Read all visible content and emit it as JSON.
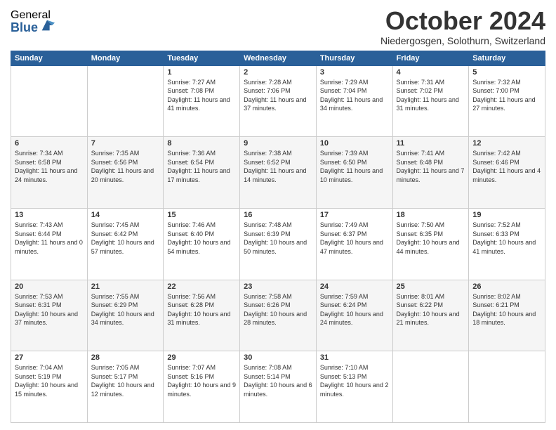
{
  "logo": {
    "general": "General",
    "blue": "Blue"
  },
  "header": {
    "month": "October 2024",
    "location": "Niedergosgen, Solothurn, Switzerland"
  },
  "weekdays": [
    "Sunday",
    "Monday",
    "Tuesday",
    "Wednesday",
    "Thursday",
    "Friday",
    "Saturday"
  ],
  "weeks": [
    [
      {
        "day": "",
        "info": ""
      },
      {
        "day": "",
        "info": ""
      },
      {
        "day": "1",
        "info": "Sunrise: 7:27 AM\nSunset: 7:08 PM\nDaylight: 11 hours and 41 minutes."
      },
      {
        "day": "2",
        "info": "Sunrise: 7:28 AM\nSunset: 7:06 PM\nDaylight: 11 hours and 37 minutes."
      },
      {
        "day": "3",
        "info": "Sunrise: 7:29 AM\nSunset: 7:04 PM\nDaylight: 11 hours and 34 minutes."
      },
      {
        "day": "4",
        "info": "Sunrise: 7:31 AM\nSunset: 7:02 PM\nDaylight: 11 hours and 31 minutes."
      },
      {
        "day": "5",
        "info": "Sunrise: 7:32 AM\nSunset: 7:00 PM\nDaylight: 11 hours and 27 minutes."
      }
    ],
    [
      {
        "day": "6",
        "info": "Sunrise: 7:34 AM\nSunset: 6:58 PM\nDaylight: 11 hours and 24 minutes."
      },
      {
        "day": "7",
        "info": "Sunrise: 7:35 AM\nSunset: 6:56 PM\nDaylight: 11 hours and 20 minutes."
      },
      {
        "day": "8",
        "info": "Sunrise: 7:36 AM\nSunset: 6:54 PM\nDaylight: 11 hours and 17 minutes."
      },
      {
        "day": "9",
        "info": "Sunrise: 7:38 AM\nSunset: 6:52 PM\nDaylight: 11 hours and 14 minutes."
      },
      {
        "day": "10",
        "info": "Sunrise: 7:39 AM\nSunset: 6:50 PM\nDaylight: 11 hours and 10 minutes."
      },
      {
        "day": "11",
        "info": "Sunrise: 7:41 AM\nSunset: 6:48 PM\nDaylight: 11 hours and 7 minutes."
      },
      {
        "day": "12",
        "info": "Sunrise: 7:42 AM\nSunset: 6:46 PM\nDaylight: 11 hours and 4 minutes."
      }
    ],
    [
      {
        "day": "13",
        "info": "Sunrise: 7:43 AM\nSunset: 6:44 PM\nDaylight: 11 hours and 0 minutes."
      },
      {
        "day": "14",
        "info": "Sunrise: 7:45 AM\nSunset: 6:42 PM\nDaylight: 10 hours and 57 minutes."
      },
      {
        "day": "15",
        "info": "Sunrise: 7:46 AM\nSunset: 6:40 PM\nDaylight: 10 hours and 54 minutes."
      },
      {
        "day": "16",
        "info": "Sunrise: 7:48 AM\nSunset: 6:39 PM\nDaylight: 10 hours and 50 minutes."
      },
      {
        "day": "17",
        "info": "Sunrise: 7:49 AM\nSunset: 6:37 PM\nDaylight: 10 hours and 47 minutes."
      },
      {
        "day": "18",
        "info": "Sunrise: 7:50 AM\nSunset: 6:35 PM\nDaylight: 10 hours and 44 minutes."
      },
      {
        "day": "19",
        "info": "Sunrise: 7:52 AM\nSunset: 6:33 PM\nDaylight: 10 hours and 41 minutes."
      }
    ],
    [
      {
        "day": "20",
        "info": "Sunrise: 7:53 AM\nSunset: 6:31 PM\nDaylight: 10 hours and 37 minutes."
      },
      {
        "day": "21",
        "info": "Sunrise: 7:55 AM\nSunset: 6:29 PM\nDaylight: 10 hours and 34 minutes."
      },
      {
        "day": "22",
        "info": "Sunrise: 7:56 AM\nSunset: 6:28 PM\nDaylight: 10 hours and 31 minutes."
      },
      {
        "day": "23",
        "info": "Sunrise: 7:58 AM\nSunset: 6:26 PM\nDaylight: 10 hours and 28 minutes."
      },
      {
        "day": "24",
        "info": "Sunrise: 7:59 AM\nSunset: 6:24 PM\nDaylight: 10 hours and 24 minutes."
      },
      {
        "day": "25",
        "info": "Sunrise: 8:01 AM\nSunset: 6:22 PM\nDaylight: 10 hours and 21 minutes."
      },
      {
        "day": "26",
        "info": "Sunrise: 8:02 AM\nSunset: 6:21 PM\nDaylight: 10 hours and 18 minutes."
      }
    ],
    [
      {
        "day": "27",
        "info": "Sunrise: 7:04 AM\nSunset: 5:19 PM\nDaylight: 10 hours and 15 minutes."
      },
      {
        "day": "28",
        "info": "Sunrise: 7:05 AM\nSunset: 5:17 PM\nDaylight: 10 hours and 12 minutes."
      },
      {
        "day": "29",
        "info": "Sunrise: 7:07 AM\nSunset: 5:16 PM\nDaylight: 10 hours and 9 minutes."
      },
      {
        "day": "30",
        "info": "Sunrise: 7:08 AM\nSunset: 5:14 PM\nDaylight: 10 hours and 6 minutes."
      },
      {
        "day": "31",
        "info": "Sunrise: 7:10 AM\nSunset: 5:13 PM\nDaylight: 10 hours and 2 minutes."
      },
      {
        "day": "",
        "info": ""
      },
      {
        "day": "",
        "info": ""
      }
    ]
  ]
}
